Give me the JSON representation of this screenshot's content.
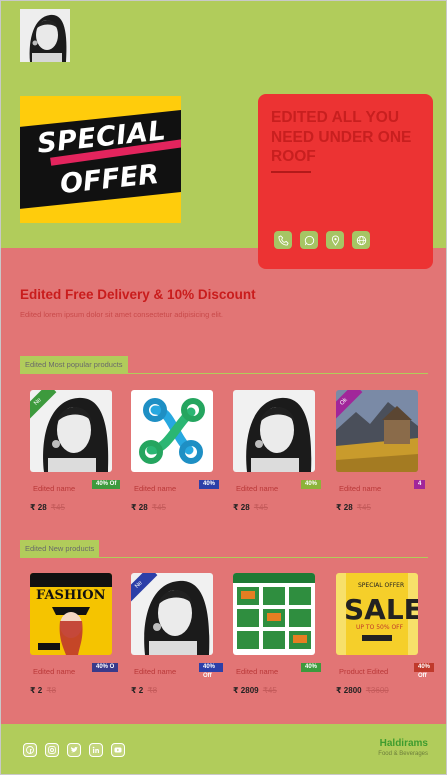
{
  "header": {
    "logo_alt": "woman portrait logo",
    "banner": {
      "line1": "SPECIAL",
      "line2": "OFFER"
    },
    "card_title": "EDITED ALL YOU NEED UNDER ONE ROOF",
    "contact_icons": [
      "phone-icon",
      "whatsapp-icon",
      "location-icon",
      "globe-icon"
    ]
  },
  "promo": {
    "headline": "Edited Free Delivery & 10% Discount",
    "subline": "Edited lorem ipsum dolor sit amet consectetur adipisicing elit."
  },
  "sections": {
    "popular_label": "Edited Most popular products",
    "new_label": "Edited New products"
  },
  "popular": [
    {
      "ribbon": "Ne",
      "name": "Edited name",
      "badge": "40% Of",
      "price": "₹ 28",
      "old": "₹45"
    },
    {
      "ribbon": "",
      "name": "Edited name",
      "badge": "40%",
      "price": "₹ 28",
      "old": "₹45"
    },
    {
      "ribbon": "",
      "name": "Edited name",
      "badge": "40%",
      "price": "₹ 28",
      "old": "₹45"
    },
    {
      "ribbon": "Ok",
      "name": "Edited name",
      "badge": "4",
      "price": "₹ 28",
      "old": "₹45"
    }
  ],
  "newp": [
    {
      "ribbon": "",
      "name": "Edited name",
      "badge": "40% O",
      "price": "₹ 2",
      "old": "₹8"
    },
    {
      "ribbon": "Ne",
      "name": "Edited name",
      "badge": "40% Off",
      "price": "₹ 2",
      "old": "₹8"
    },
    {
      "ribbon": "",
      "name": "Edited name",
      "badge": "40%",
      "price": "₹ 2809",
      "old": "₹45"
    },
    {
      "ribbon": "",
      "name": "Product Edited",
      "badge": "40% Off",
      "price": "₹ 2800",
      "old": "₹3600"
    }
  ],
  "footer": {
    "brand": "Haldirams",
    "tag": "Food & Beverages",
    "social": [
      "facebook-icon",
      "instagram-icon",
      "twitter-icon",
      "linkedin-icon",
      "youtube-icon"
    ]
  },
  "colors": {
    "header": "#b1cc5b",
    "body": "#e27575",
    "card": "#ec3333"
  }
}
